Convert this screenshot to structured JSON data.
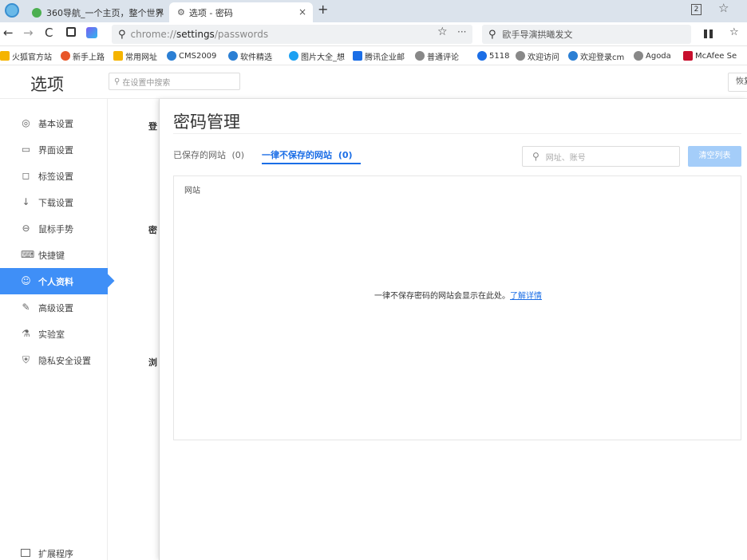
{
  "browser": {
    "tabs": [
      {
        "title": "360导航_一个主页，整个世界",
        "close": "×"
      },
      {
        "title": "选项 - 密码",
        "close": "×"
      }
    ],
    "new_tab": "+",
    "window_controls": [
      "2",
      "☆"
    ]
  },
  "toolbar": {
    "url_scheme": "chrome://",
    "url_host": "settings",
    "url_path": "/passwords",
    "star": "☆",
    "more": "···",
    "search_value": "歐手导演拱曦发文"
  },
  "bookmarks": [
    {
      "label": "火狐官方站",
      "color": "#f5b400"
    },
    {
      "label": "新手上路",
      "color": "#e8572a"
    },
    {
      "label": "常用网址",
      "color": "#f5b400"
    },
    {
      "label": "CMS2009",
      "color": "#2b7fd4"
    },
    {
      "label": "软件精选",
      "color": "#2b7fd4"
    },
    {
      "label": "图片大全_想",
      "color": "#1da1f2"
    },
    {
      "label": "腾讯企业邮",
      "color": "#1b6ee6"
    },
    {
      "label": "普通评论",
      "color": "#888888"
    },
    {
      "label": "5118",
      "color": "#1b6ee6"
    },
    {
      "label": "欢迎访问",
      "color": "#888888"
    },
    {
      "label": "欢迎登录cm",
      "color": "#2b7fd4"
    },
    {
      "label": "Agoda",
      "color": "#888888"
    },
    {
      "label": "McAfee Se",
      "color": "#c8102e"
    }
  ],
  "settings": {
    "page_title": "选项",
    "search_placeholder": "在设置中搜索",
    "restore_label": "恢复"
  },
  "sidebar": {
    "items": [
      {
        "label": "基本设置",
        "icon": "◎"
      },
      {
        "label": "界面设置",
        "icon": "▭"
      },
      {
        "label": "标签设置",
        "icon": "◻"
      },
      {
        "label": "下载设置",
        "icon": "↓"
      },
      {
        "label": "鼠标手势",
        "icon": "⊖"
      },
      {
        "label": "快捷键",
        "icon": "⌨"
      },
      {
        "label": "个人资料",
        "icon": "☺"
      },
      {
        "label": "高级设置",
        "icon": "✎"
      },
      {
        "label": "实验室",
        "icon": "⚗"
      },
      {
        "label": "隐私安全设置",
        "icon": "⛨"
      }
    ],
    "extensions_label": "扩展程序"
  },
  "background_sections": [
    "登",
    "密",
    "浏"
  ],
  "dialog": {
    "title": "密码管理",
    "tabs": [
      {
        "label": "已保存的网站",
        "count": "(0)"
      },
      {
        "label": "一律不保存的网站",
        "count": "(0)"
      }
    ],
    "search_placeholder": "网址、账号",
    "clear_button": "清空列表",
    "list_header": "网站",
    "empty_message": "一律不保存密码的网站会显示在此处。",
    "learn_more": "了解详情"
  }
}
